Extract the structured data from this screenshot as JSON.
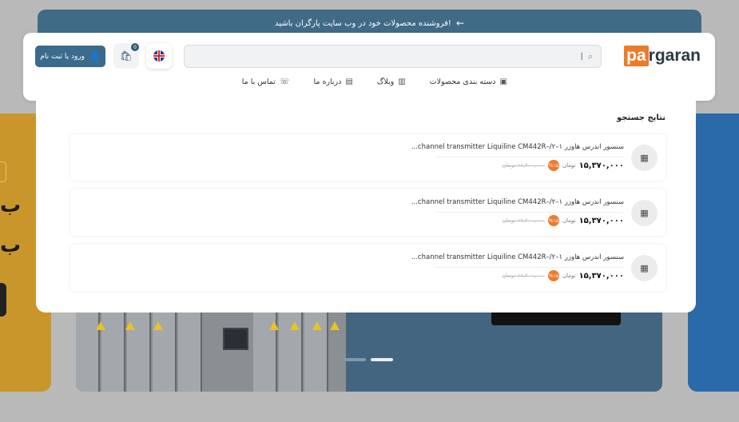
{
  "colors": {
    "brand_orange": "#f0792a",
    "brand_blue": "#3b6b8c"
  },
  "banner": {
    "text": "فروشنده محصولات خود در وب سایت پارگران باشید!",
    "arrow_icon": "arrow-left-icon"
  },
  "header": {
    "logo": {
      "part1": "pa",
      "part2": "rgaran"
    },
    "search": {
      "placeholder": "",
      "value": "|",
      "icon": "search-icon"
    },
    "lang_icon": "uk-flag-icon",
    "cart": {
      "count": "0",
      "icon": "basket-icon"
    },
    "login_label": "ورود یا ثبت نام",
    "nav": [
      {
        "label": "دسته بندی محصولات",
        "icon": "grid-icon"
      },
      {
        "label": "وبلاگ",
        "icon": "book-icon"
      },
      {
        "label": "درباره ما",
        "icon": "building-icon"
      },
      {
        "label": "تماس با ما",
        "icon": "phone-icon"
      }
    ]
  },
  "results": {
    "title": "نتایج جستجو",
    "items": [
      {
        "title": "سنسور اندرس هاوزر ۱–۲/–channel transmitter Liquiline CM442R...",
        "price": "۱۵,۳۷۰,۰۰۰",
        "currency": "تومان",
        "discount": "%۱۵",
        "old_price": "۱۶,۲۰۰,۰۰۰ تومان"
      },
      {
        "title": "سنسور اندرس هاوزر ۱–۲/–channel transmitter Liquiline CM442R...",
        "price": "۱۵,۳۷۰,۰۰۰",
        "currency": "تومان",
        "discount": "%۱۵",
        "old_price": "۱۶,۲۰۰,۰۰۰ تومان"
      },
      {
        "title": "سنسور اندرس هاوزر ۱–۲/–channel transmitter Liquiline CM442R...",
        "price": "۱۵,۳۷۰,۰۰۰",
        "currency": "تومان",
        "discount": "%۱۵",
        "old_price": "۱۶,۲۰۰,۰۰۰ تومان"
      }
    ]
  },
  "slider": {
    "active_index": 1,
    "count": 2
  }
}
